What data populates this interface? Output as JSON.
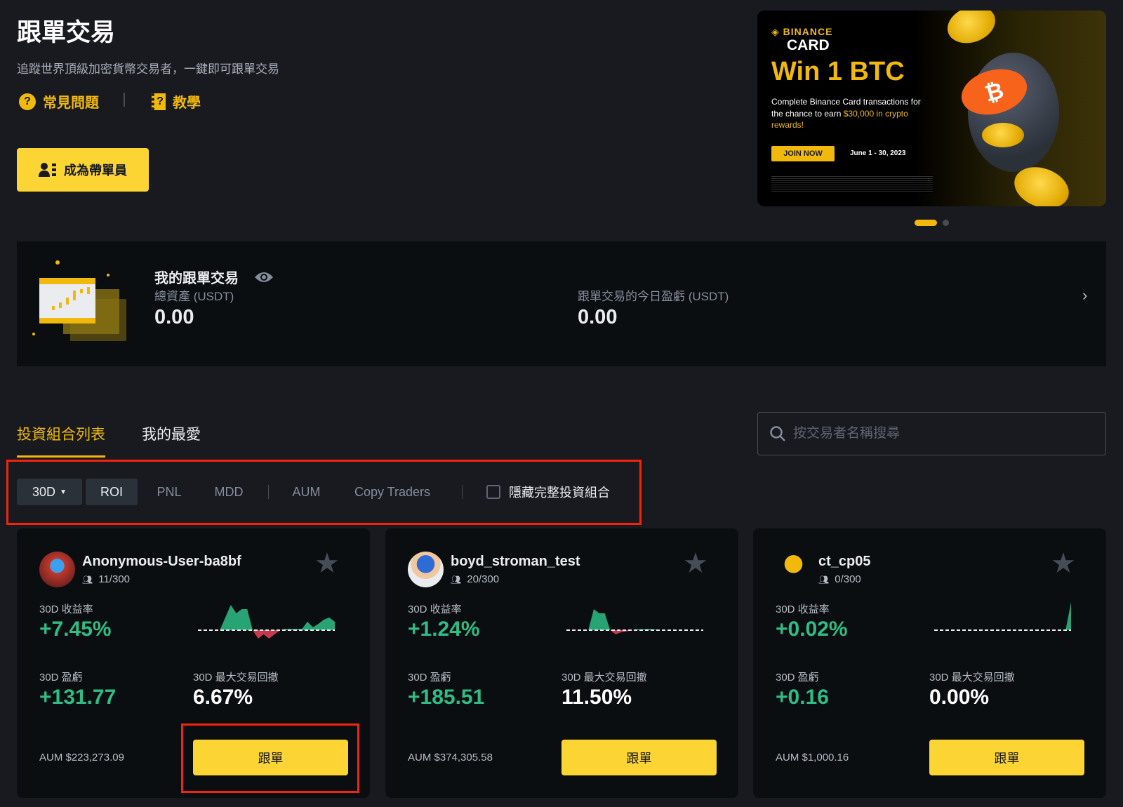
{
  "header": {
    "title": "跟單交易",
    "subtitle": "追蹤世界頂級加密貨幣交易者，一鍵即可跟單交易",
    "faq_label": "常見問題",
    "tutorial_label": "教學",
    "become_lead_label": "成為帶單員"
  },
  "banner": {
    "brand": "BINANCE",
    "brand_sub": "CARD",
    "headline": "Win 1 BTC",
    "desc_line": "Complete Binance Card transactions for the chance to earn",
    "desc_highlight": "$30,000 in crypto rewards!",
    "cta": "JOIN NOW",
    "dates": "June 1 - 30, 2023",
    "active_slide": 1,
    "slide_count": 2
  },
  "my_copy": {
    "title": "我的跟單交易",
    "total_assets_label": "總資產 (USDT)",
    "total_assets": "0.00",
    "today_pnl_label": "跟單交易的今日盈虧 (USDT)",
    "today_pnl": "0.00"
  },
  "tabs": [
    {
      "label": "投資組合列表",
      "active": true
    },
    {
      "label": "我的最愛",
      "active": false
    }
  ],
  "search": {
    "placeholder": "按交易者名稱搜尋",
    "value": ""
  },
  "filters": {
    "period": "30D",
    "sort_options": [
      "ROI",
      "PNL",
      "MDD",
      "AUM",
      "Copy Traders"
    ],
    "selected": "ROI",
    "hide_full_label": "隱藏完整投資組合",
    "hide_full_checked": false
  },
  "colors": {
    "accent": "#fcd535",
    "positive": "#2ebd85",
    "negative": "#f6465d",
    "highlight_box": "#f6230c"
  },
  "traders": [
    {
      "name": "Anonymous-User-ba8bf",
      "followers": "11/300",
      "roi_label": "30D 收益率",
      "roi": "+7.45%",
      "pnl_label": "30D 盈虧",
      "pnl": "+131.77",
      "mdd_label": "30D 最大交易回撤",
      "mdd": "6.67%",
      "aum": "AUM $223,273.09",
      "follow_label": "跟單",
      "roi_trend": [
        0,
        0,
        0,
        0,
        0,
        3,
        6,
        4,
        5,
        5,
        0,
        -2,
        -1,
        -2,
        -1,
        0,
        0.3,
        0.3,
        0.3,
        0.3,
        2,
        0.7,
        1.5,
        2.5,
        3,
        2
      ]
    },
    {
      "name": "boyd_stroman_test",
      "followers": "20/300",
      "roi_label": "30D 收益率",
      "roi": "+1.24%",
      "pnl_label": "30D 盈虧",
      "pnl": "+185.51",
      "mdd_label": "30D 最大交易回撤",
      "mdd": "11.50%",
      "aum": "AUM $374,305.58",
      "follow_label": "跟單",
      "roi_trend": [
        0,
        0,
        0,
        0,
        0,
        5,
        4,
        4,
        0,
        -1,
        -0.5,
        -0.3,
        0,
        0.2,
        0.2,
        0.3,
        0.2,
        0,
        0,
        0,
        0,
        0,
        0,
        0,
        0,
        0
      ]
    },
    {
      "name": "ct_cp05",
      "followers": "0/300",
      "roi_label": "30D 收益率",
      "roi": "+0.02%",
      "pnl_label": "30D 盈虧",
      "pnl": "+0.16",
      "mdd_label": "30D 最大交易回撤",
      "mdd": "0.00%",
      "aum": "AUM $1,000.16",
      "follow_label": "跟單",
      "roi_trend": [
        0,
        0,
        0,
        0,
        0,
        0,
        0,
        0,
        0,
        0,
        0,
        0,
        0,
        0,
        0,
        0,
        0,
        0,
        0,
        0,
        0,
        0,
        0,
        0,
        0,
        8
      ]
    }
  ]
}
